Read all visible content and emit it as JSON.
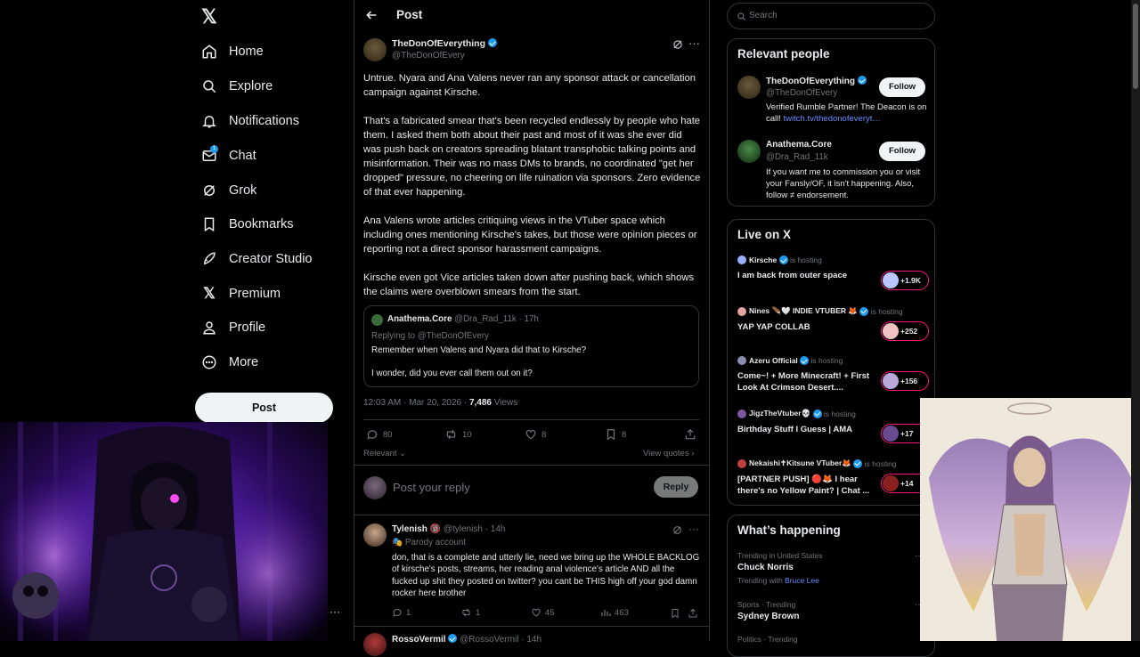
{
  "nav": {
    "items": [
      {
        "label": "Home",
        "icon": "home-icon"
      },
      {
        "label": "Explore",
        "icon": "search-icon"
      },
      {
        "label": "Notifications",
        "icon": "bell-icon"
      },
      {
        "label": "Chat",
        "icon": "mail-icon",
        "badge": "1"
      },
      {
        "label": "Grok",
        "icon": "grok-icon"
      },
      {
        "label": "Bookmarks",
        "icon": "bookmark-icon"
      },
      {
        "label": "Creator Studio",
        "icon": "rocket-icon"
      },
      {
        "label": "Premium",
        "icon": "x-logo-icon"
      },
      {
        "label": "Profile",
        "icon": "person-icon"
      },
      {
        "label": "More",
        "icon": "more-circle-icon"
      }
    ],
    "post_label": "Post"
  },
  "header": {
    "title": "Post"
  },
  "main_post": {
    "name": "TheDonOfEverything",
    "handle": "@TheDonOfEvery",
    "paragraphs": [
      "Untrue. Nyara and Ana Valens never ran any sponsor attack or cancellation campaign against Kirsche.",
      "That's a fabricated smear that's been recycled endlessly by people who hate them. I asked them both about their past and most of it was she ever did was push back on creators spreading blatant transphobic talking points and misinformation. Their was no mass DMs to brands, no coordinated \"get her dropped\" pressure, no cheering on life ruination via sponsors. Zero evidence of that ever happening.",
      "Ana Valens wrote articles critiquing views in the VTuber space which including ones mentioning Kirsche's takes, but those were opinion pieces or reporting not a direct sponsor harassment campaigns.",
      "Kirsche even got Vice articles taken down after pushing back, which shows the claims were overblown smears from the start."
    ],
    "quote": {
      "name": "Anathema.Core",
      "handle": "@Dra_Rad_11k",
      "time": "· 17h",
      "replying": "Replying to @TheDonOfEvery",
      "line1": "Remember when Valens and Nyara did that to Kirsche?",
      "line2": "I wonder, did you ever call them out on it?"
    },
    "timestamp": "12:03 AM · Mar 20, 2026 ·",
    "views_count": "7,486",
    "views_label": "Views",
    "replies": "80",
    "reposts": "10",
    "likes": "8",
    "bookmarks": "8",
    "relevant": "Relevant",
    "view_quotes": "View quotes"
  },
  "composer": {
    "placeholder": "Post your reply",
    "button": "Reply"
  },
  "reply1": {
    "name": "Tylenish",
    "emoji": "🔞",
    "handle": "@tylenish · 14h",
    "parody": "Parody account",
    "text": "don, that is a complete and utterly lie, need we bring up the WHOLE BACKLOG of kirsche's posts, streams, her reading anal violence's article AND all the fucked up shit they posted on twitter? you cant be THIS high off your god damn rocker here brother",
    "replies": "1",
    "reposts": "1",
    "likes": "45",
    "views": "463"
  },
  "reply2": {
    "name": "RossoVermil",
    "handle": "@RossoVermil · 14h"
  },
  "search": {
    "placeholder": "Search"
  },
  "relevant_people": {
    "title": "Relevant people",
    "people": [
      {
        "name": "TheDonOfEverything",
        "handle": "@TheDonOfEvery",
        "bio": "Verified Rumble Partner! The Deacon is on call!",
        "link": "twitch.tv/thedonofeveryt…",
        "follow": "Follow"
      },
      {
        "name": "Anathema.Core",
        "handle": "@Dra_Rad_11k",
        "bio": "If you want me to commission you or visit your Fansly/OF, it isn't happening. Also, follow ≠ endorsement.",
        "follow": "Follow"
      }
    ]
  },
  "live": {
    "title": "Live on X",
    "hosting": "is hosting",
    "items": [
      {
        "host": "Kirsche",
        "title": "I am back from outer space",
        "count": "+1.9K"
      },
      {
        "host": "Nines 🪶🤍 INDIE VTUBER 🦊",
        "title": "YAP YAP COLLAB",
        "count": "+252"
      },
      {
        "host": "Azeru Official",
        "title": "Come~! + More Minecraft! + First Look At Crimson Desert....",
        "count": "+156"
      },
      {
        "host": "JigzTheVtuber💀",
        "title": "Birthday Stuff I Guess | AMA",
        "count": "+17"
      },
      {
        "host": "Nekaishi✝Kitsune VTuber🦊",
        "title": "[PARTNER PUSH] 🔴🦊 I hear there's no Yellow Paint? | Chat ...",
        "count": "+14"
      }
    ]
  },
  "happening": {
    "title": "What’s happening",
    "items": [
      {
        "context": "Trending in United States",
        "name": "Chuck Norris",
        "sub_prefix": "Trending with",
        "sub_link": "Bruce Lee"
      },
      {
        "context": "Sports · Trending",
        "name": "Sydney Brown"
      },
      {
        "context": "Politics · Trending",
        "name": ""
      }
    ]
  }
}
